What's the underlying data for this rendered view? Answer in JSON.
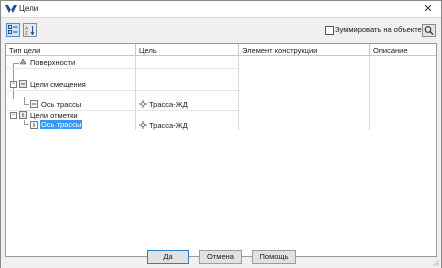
{
  "window": {
    "title": "Цели",
    "app_icon": "app-logo-icon",
    "close_icon": "close-icon"
  },
  "toolbar": {
    "sort_category_icon": "sort-by-category-icon",
    "sort_alpha_icon": "sort-alphabetical-icon",
    "sum_on_object_label": "Зуммировать на объекте",
    "sum_on_object_checked": false,
    "search_icon": "search-icon"
  },
  "grid": {
    "columns": [
      "Тип цели",
      "Цель",
      "Элемент конструкции",
      "Описание"
    ],
    "rows": [
      {
        "label": "Поверхности",
        "level": 0,
        "expander": "",
        "icon": "surface-icon",
        "target": ""
      },
      {
        "label": "Цели смещения",
        "level": 0,
        "expander": "−",
        "icon": "offset-targets-icon",
        "target": ""
      },
      {
        "label": "Ось трассы",
        "level": 1,
        "expander": "",
        "icon": "alignment-icon",
        "target": "Трасса-ЖД"
      },
      {
        "label": "Цели отметки",
        "level": 0,
        "expander": "−",
        "icon": "elevation-targets-icon",
        "target": ""
      },
      {
        "label": "Ось трассы",
        "level": 1,
        "expander": "",
        "icon": "profile-icon",
        "target": "Трасса-ЖД",
        "selected": true
      }
    ]
  },
  "footer": {
    "ok_label": "Да",
    "cancel_label": "Отмена",
    "help_label": "Помощь"
  },
  "colors": {
    "selection": "#3399ff",
    "default_button_border": "#2f7fd0"
  }
}
